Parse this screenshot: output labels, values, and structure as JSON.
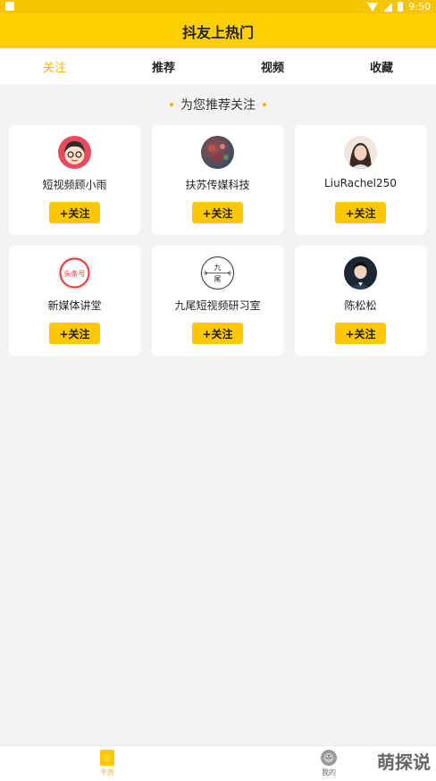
{
  "status_bar": {
    "time": "9:50"
  },
  "header": {
    "title": "抖友上热门"
  },
  "tabs": [
    {
      "label": "关注",
      "active": true
    },
    {
      "label": "推荐",
      "active": false
    },
    {
      "label": "视频",
      "active": false
    },
    {
      "label": "收藏",
      "active": false
    }
  ],
  "section": {
    "title": "为您推荐关注"
  },
  "recommendations": [
    {
      "name": "短视频顾小雨",
      "follow_label": "+关注",
      "avatar": "cartoon-girl-avatar"
    },
    {
      "name": "扶苏传媒科技",
      "follow_label": "+关注",
      "avatar": "flower-photo-avatar"
    },
    {
      "name": "LiuRachel250",
      "follow_label": "+关注",
      "avatar": "woman-photo-avatar"
    },
    {
      "name": "新媒体讲堂",
      "follow_label": "+关注",
      "avatar": "toutiao-logo-avatar",
      "logo_text": "头条号"
    },
    {
      "name": "九尾短视频研习室",
      "follow_label": "+关注",
      "avatar": "jiuwei-logo-avatar",
      "logo_text": "九尾"
    },
    {
      "name": "陈松松",
      "follow_label": "+关注",
      "avatar": "man-photo-avatar"
    }
  ],
  "bottom_nav": [
    {
      "label": "干货",
      "icon": "star-icon",
      "active": true
    },
    {
      "label": "我的",
      "icon": "smile-icon",
      "active": false
    }
  ],
  "watermark": "萌探说",
  "colors": {
    "header": "#ffd000",
    "accent": "#f5b400",
    "button": "#ffc800"
  }
}
